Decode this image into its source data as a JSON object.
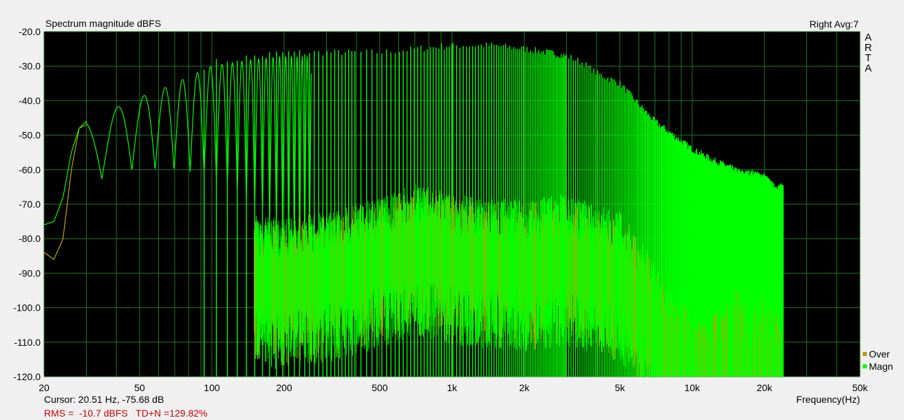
{
  "header": {
    "title": "Spectrum magnitude dBFS",
    "channel_info": "Right  Avg:7",
    "brand_letters": [
      "A",
      "R",
      "T",
      "A"
    ]
  },
  "status": {
    "cursor": "Cursor: 20.51 Hz, -75.68 dB",
    "rms_thd": "RMS =  -10.7 dBFS   TD+N =129.82%"
  },
  "legend": [
    {
      "label": "Over",
      "color": "#b5a000"
    },
    {
      "label": "Magn",
      "color": "#00ff00"
    }
  ],
  "colors": {
    "plot_background": "#000000",
    "grid": "#1f7a1f",
    "magn": "#00ff00",
    "over": "#c8a000",
    "status_text": "#cc0000"
  },
  "chart_data": {
    "type": "line",
    "title": "Spectrum magnitude dBFS",
    "xlabel": "Frequency(Hz)",
    "ylabel": "",
    "x_scale": "log",
    "xlim": [
      20,
      50000
    ],
    "ylim": [
      -120,
      -20
    ],
    "grid": true,
    "legend_position": "bottom-right",
    "x_tick_labels": [
      {
        "value": 20,
        "label": "20"
      },
      {
        "value": 50,
        "label": "50"
      },
      {
        "value": 100,
        "label": "100"
      },
      {
        "value": 200,
        "label": "200"
      },
      {
        "value": 500,
        "label": "500"
      },
      {
        "value": 1000,
        "label": "1k"
      },
      {
        "value": 2000,
        "label": "2k"
      },
      {
        "value": 5000,
        "label": "5k"
      },
      {
        "value": 10000,
        "label": "10k"
      },
      {
        "value": 20000,
        "label": "20k"
      },
      {
        "value": 50000,
        "label": "50k"
      }
    ],
    "y_tick_labels": [
      "-20.0",
      "-30.0",
      "-40.0",
      "-50.0",
      "-60.0",
      "-70.0",
      "-80.0",
      "-90.0",
      "-100.0",
      "-110.0",
      "-120.0"
    ],
    "y_ticks": [
      -20,
      -30,
      -40,
      -50,
      -60,
      -70,
      -80,
      -90,
      -100,
      -110,
      -120
    ],
    "series": [
      {
        "name": "Magn",
        "color": "#00ff00",
        "envelope": [
          [
            20,
            -76
          ],
          [
            22,
            -75
          ],
          [
            24,
            -68
          ],
          [
            26,
            -55
          ],
          [
            28,
            -48
          ],
          [
            30,
            -46
          ],
          [
            35,
            -45
          ],
          [
            40,
            -42
          ],
          [
            50,
            -39
          ],
          [
            60,
            -37
          ],
          [
            70,
            -35
          ],
          [
            80,
            -33
          ],
          [
            100,
            -30
          ],
          [
            150,
            -28
          ],
          [
            200,
            -27
          ],
          [
            300,
            -27
          ],
          [
            500,
            -27
          ],
          [
            700,
            -26
          ],
          [
            1000,
            -25
          ],
          [
            1500,
            -25
          ],
          [
            2000,
            -26
          ],
          [
            2500,
            -27
          ],
          [
            3000,
            -28
          ],
          [
            3500,
            -30
          ],
          [
            4000,
            -33
          ],
          [
            5000,
            -36
          ],
          [
            6000,
            -42
          ],
          [
            7000,
            -47
          ],
          [
            8000,
            -50
          ],
          [
            10000,
            -55
          ],
          [
            12000,
            -58
          ],
          [
            14000,
            -60
          ],
          [
            16000,
            -62
          ],
          [
            18000,
            -62
          ],
          [
            20000,
            -63
          ],
          [
            22000,
            -66
          ]
        ],
        "noise_floor": [
          [
            20,
            -76
          ],
          [
            100,
            -88
          ],
          [
            200,
            -90
          ],
          [
            300,
            -88
          ],
          [
            500,
            -84
          ],
          [
            700,
            -80
          ],
          [
            1000,
            -83
          ],
          [
            2000,
            -85
          ],
          [
            3000,
            -83
          ],
          [
            4000,
            -86
          ],
          [
            5000,
            -88
          ],
          [
            6000,
            -95
          ],
          [
            7000,
            -103
          ],
          [
            8000,
            -110
          ],
          [
            10000,
            -118
          ],
          [
            12000,
            -119
          ],
          [
            15000,
            -110
          ],
          [
            17000,
            -117
          ],
          [
            20000,
            -112
          ],
          [
            24000,
            -118
          ]
        ]
      },
      {
        "name": "Over",
        "color": "#c8a000",
        "envelope": [
          [
            20,
            -84
          ],
          [
            22,
            -86
          ],
          [
            24,
            -80
          ],
          [
            26,
            -60
          ],
          [
            28,
            -48
          ],
          [
            30,
            -47
          ]
        ]
      }
    ]
  }
}
